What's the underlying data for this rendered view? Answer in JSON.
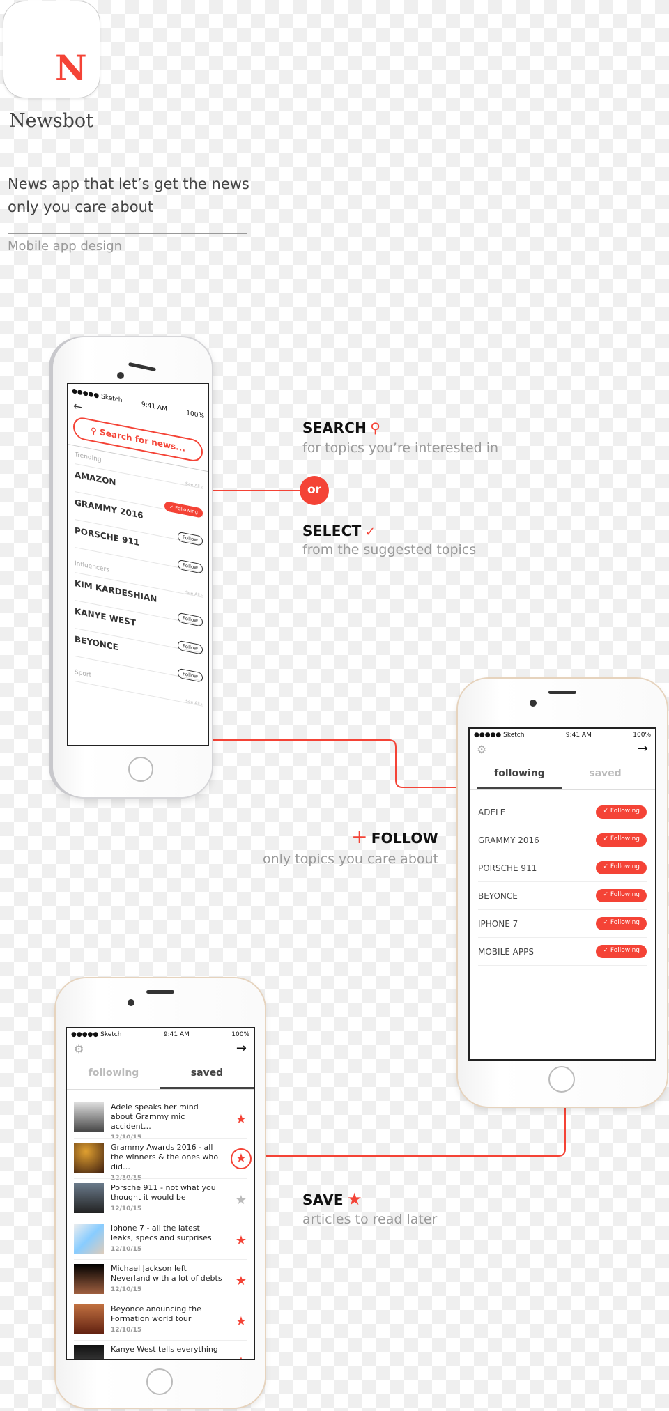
{
  "app": {
    "icon_letter": "N",
    "name": "Newsbot",
    "description": "News app that let’s get the news only you care about",
    "category": "Mobile app design"
  },
  "accent": "#f44336",
  "features": {
    "search": {
      "title": "SEARCH",
      "subtitle": "for topics you’re interested in"
    },
    "or": "or",
    "select": {
      "title": "SELECT",
      "subtitle": "from the suggested topics"
    },
    "follow": {
      "title": "FOLLOW",
      "subtitle": "only topics you care about"
    },
    "save": {
      "title": "SAVE",
      "subtitle": "articles to read later"
    }
  },
  "status": {
    "carrier": "●●●●● Sketch",
    "time": "9:41 AM",
    "battery": "100%"
  },
  "search_screen": {
    "search_placeholder": "Search for news...",
    "sections": [
      {
        "title": "Trending",
        "see_all": "See All ›",
        "items": [
          {
            "name": "AMAZON",
            "button": "✓ Following",
            "following": true
          },
          {
            "name": "GRAMMY 2016",
            "button": "Follow",
            "following": false
          },
          {
            "name": "PORSCHE 911",
            "button": "Follow",
            "following": false
          }
        ]
      },
      {
        "title": "Influencers",
        "see_all": "See All ›",
        "items": [
          {
            "name": "KIM KARDESHIAN",
            "button": "Follow",
            "following": false
          },
          {
            "name": "KANYE WEST",
            "button": "Follow",
            "following": false
          },
          {
            "name": "BEYONCE",
            "button": "Follow",
            "following": false
          }
        ]
      },
      {
        "title": "Sport",
        "see_all": "See All ›",
        "items": []
      }
    ]
  },
  "following_screen": {
    "tabs": [
      "following",
      "saved"
    ],
    "active_tab": 0,
    "button_label": "✓ Following",
    "topics": [
      "ADELE",
      "GRAMMY 2016",
      "PORSCHE 911",
      "BEYONCE",
      "IPHONE 7",
      "MOBILE APPS"
    ]
  },
  "saved_screen": {
    "tabs": [
      "following",
      "saved"
    ],
    "active_tab": 1,
    "articles": [
      {
        "title": "Adele speaks her mind about Grammy mic accident…",
        "date": "12/10/15",
        "saved": true
      },
      {
        "title": "Grammy Awards 2016 - all the winners & the ones who did…",
        "date": "12/10/15",
        "saved": true,
        "highlighted": true
      },
      {
        "title": "Porsche 911 - not what you thought it would be",
        "date": "12/10/15",
        "saved": false
      },
      {
        "title": "iphone 7 - all the latest leaks, specs and surprises",
        "date": "12/10/15",
        "saved": true
      },
      {
        "title": "Michael Jackson left Neverland with a lot of debts",
        "date": "12/10/15",
        "saved": true
      },
      {
        "title": "Beyonce anouncing the Formation world tour",
        "date": "12/10/15",
        "saved": true
      },
      {
        "title": "Kanye West tells everything",
        "date": "",
        "saved": true
      }
    ]
  }
}
